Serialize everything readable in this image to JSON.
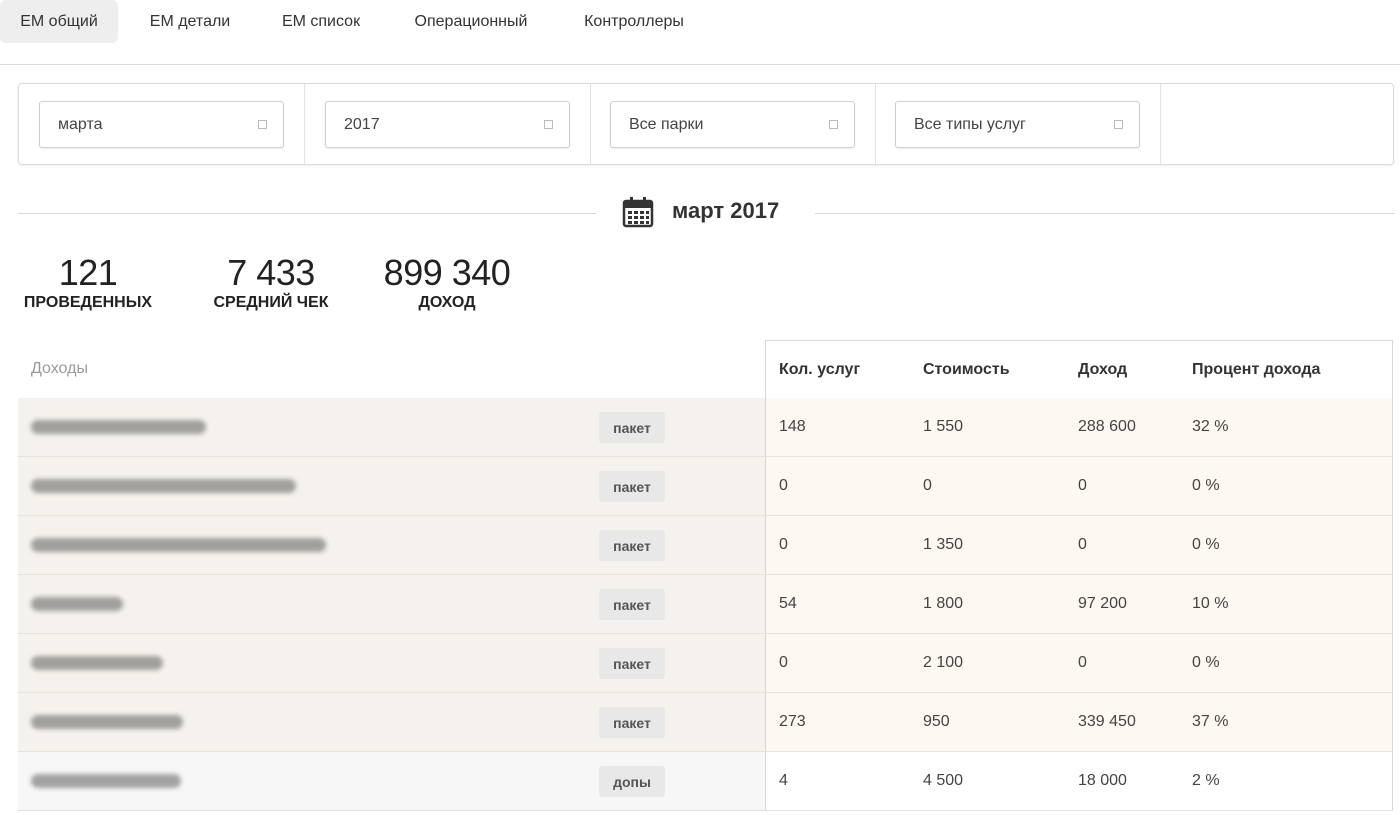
{
  "tabs": [
    {
      "label": "ЕМ общий",
      "active": true
    },
    {
      "label": "ЕМ детали",
      "active": false
    },
    {
      "label": "ЕМ список",
      "active": false
    },
    {
      "label": "Операционный",
      "active": false
    },
    {
      "label": "Контроллеры",
      "active": false
    }
  ],
  "filters": {
    "month": "марта",
    "year": "2017",
    "park": "Все парки",
    "service_type": "Все типы услуг"
  },
  "period": {
    "title": "март 2017"
  },
  "kpis": [
    {
      "value": "121",
      "label": "ПРОВЕДЕННЫХ"
    },
    {
      "value": "7 433",
      "label": "СРЕДНИЙ ЧЕК"
    },
    {
      "value": "899 340",
      "label": "ДОХОД"
    }
  ],
  "table": {
    "section_label": "Доходы",
    "columns": [
      "Кол. услуг",
      "Стоимость",
      "Доход",
      "Процент дохода"
    ],
    "rows": [
      {
        "badge": "пакет",
        "count": "148",
        "price": "1 550",
        "income": "288 600",
        "percent": "32 %"
      },
      {
        "badge": "пакет",
        "count": "0",
        "price": "0",
        "income": "0",
        "percent": "0 %"
      },
      {
        "badge": "пакет",
        "count": "0",
        "price": "1 350",
        "income": "0",
        "percent": "0 %"
      },
      {
        "badge": "пакет",
        "count": "54",
        "price": "1 800",
        "income": "97 200",
        "percent": "10 %"
      },
      {
        "badge": "пакет",
        "count": "0",
        "price": "2 100",
        "income": "0",
        "percent": "0 %"
      },
      {
        "badge": "пакет",
        "count": "273",
        "price": "950",
        "income": "339 450",
        "percent": "37 %"
      },
      {
        "badge": "допы",
        "count": "4",
        "price": "4 500",
        "income": "18 000",
        "percent": "2 %"
      }
    ]
  }
}
